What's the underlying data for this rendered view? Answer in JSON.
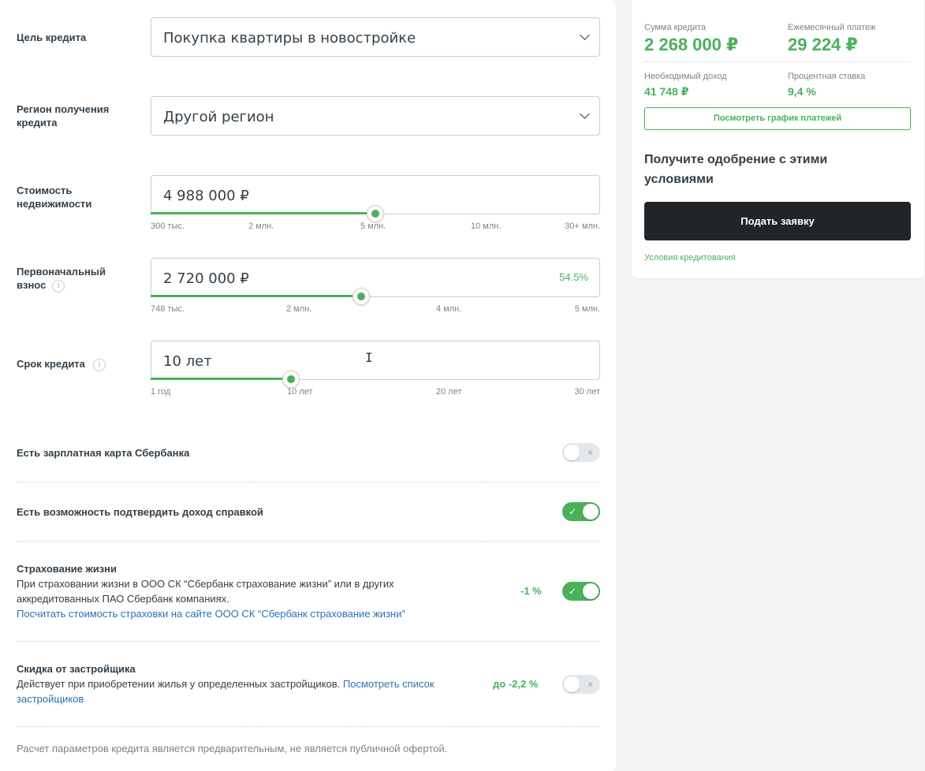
{
  "form": {
    "purpose": {
      "label": "Цель кредита",
      "value": "Покупка квартиры в новостройке"
    },
    "region": {
      "label": "Регион получения кредита",
      "value": "Другой регион"
    },
    "property_cost": {
      "label": "Стоимость недвижимости",
      "value": "4 988 000 ₽",
      "slider_fraction": 0.5,
      "ticks": [
        "300 тыс.",
        "2 млн.",
        "5 млн.",
        "10 млн.",
        "30+ млн."
      ]
    },
    "down_payment": {
      "label": "Первоначальный взнос",
      "value": "2 720 000 ₽",
      "percent": "54.5%",
      "slider_fraction": 0.47,
      "ticks": [
        "748 тыс.",
        "2 млн.",
        "4 млн.",
        "5 млн."
      ]
    },
    "term": {
      "label": "Срок кредита",
      "value": "10 лет",
      "slider_fraction": 0.31,
      "ticks": [
        "1 год",
        "10 лет",
        "20 лет",
        "30 лет"
      ]
    },
    "salary_card": {
      "label": "Есть зарплатная карта Сбербанка",
      "enabled": false
    },
    "income_proof": {
      "label": "Есть возможность подтвердить доход справкой",
      "enabled": true
    },
    "life_insurance": {
      "title": "Страхование жизни",
      "description": "При страховании жизни в ООО СК “Сбербанк страхование жизни” или в других аккредитованных ПАО Сбербанк компаниях.",
      "link": "Посчитать стоимость страховки на сайте ООО СК “Сбербанк страхование жизни”",
      "discount": "-1 %",
      "enabled": true
    },
    "developer_discount": {
      "title": "Скидка от застройщика",
      "description": "Действует при приобретении жилья у определенных застройщиков.",
      "link": "Посмотреть список застройщиков",
      "discount": "до -2,2 %",
      "enabled": false
    },
    "footnote": "Расчет параметров кредита является предварительным, не является публичной офертой."
  },
  "summary": {
    "loan_amount_label": "Сумма кредита",
    "loan_amount": "2 268 000 ₽",
    "monthly_payment_label": "Ежемесячный платеж",
    "monthly_payment": "29 224 ₽",
    "required_income_label": "Необходимый доход",
    "required_income": "41 748 ₽",
    "rate_label": "Процентная ставка",
    "rate": "9,4 %",
    "schedule_button": "Посмотреть график платежей",
    "approval_title": "Получите одобрение с этими условиями",
    "apply_button": "Подать заявку",
    "conditions_link": "Условия кредитования"
  },
  "colors": {
    "accent": "#4cb05b",
    "link": "#2a72b5",
    "dark_button": "#21252a"
  },
  "icons": {
    "check": "✓",
    "cross": "×",
    "info": "i"
  }
}
